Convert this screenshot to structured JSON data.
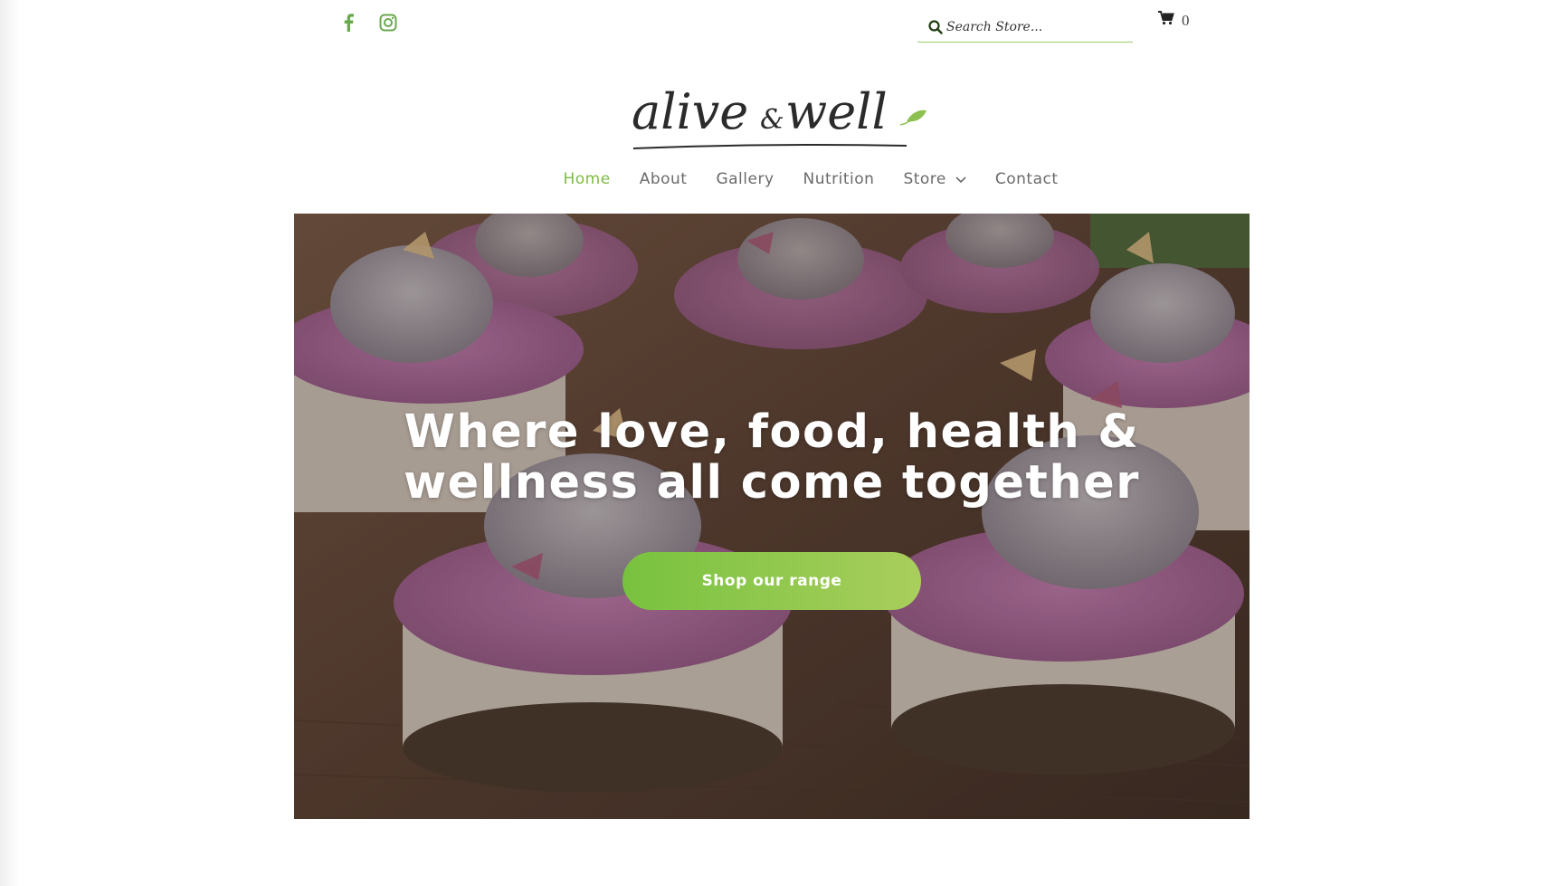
{
  "brand": {
    "logo_text_1": "alive",
    "logo_ampersand": "&",
    "logo_text_2": "well",
    "accent_color": "#7dbb42",
    "leaf_color": "#8cc152"
  },
  "topbar": {
    "social": [
      {
        "icon": "facebook-icon",
        "label": "Facebook"
      },
      {
        "icon": "instagram-icon",
        "label": "Instagram"
      }
    ],
    "search": {
      "placeholder": "Search Store..."
    },
    "cart": {
      "count": "0"
    }
  },
  "nav": {
    "items": [
      {
        "label": "Home",
        "active": true
      },
      {
        "label": "About"
      },
      {
        "label": "Gallery"
      },
      {
        "label": "Nutrition"
      },
      {
        "label": "Store",
        "has_dropdown": true
      },
      {
        "label": "Contact"
      }
    ]
  },
  "hero": {
    "title_line_1": "Where love, food, health &",
    "title_line_2": "wellness all come together",
    "cta_label": "Shop our range"
  }
}
